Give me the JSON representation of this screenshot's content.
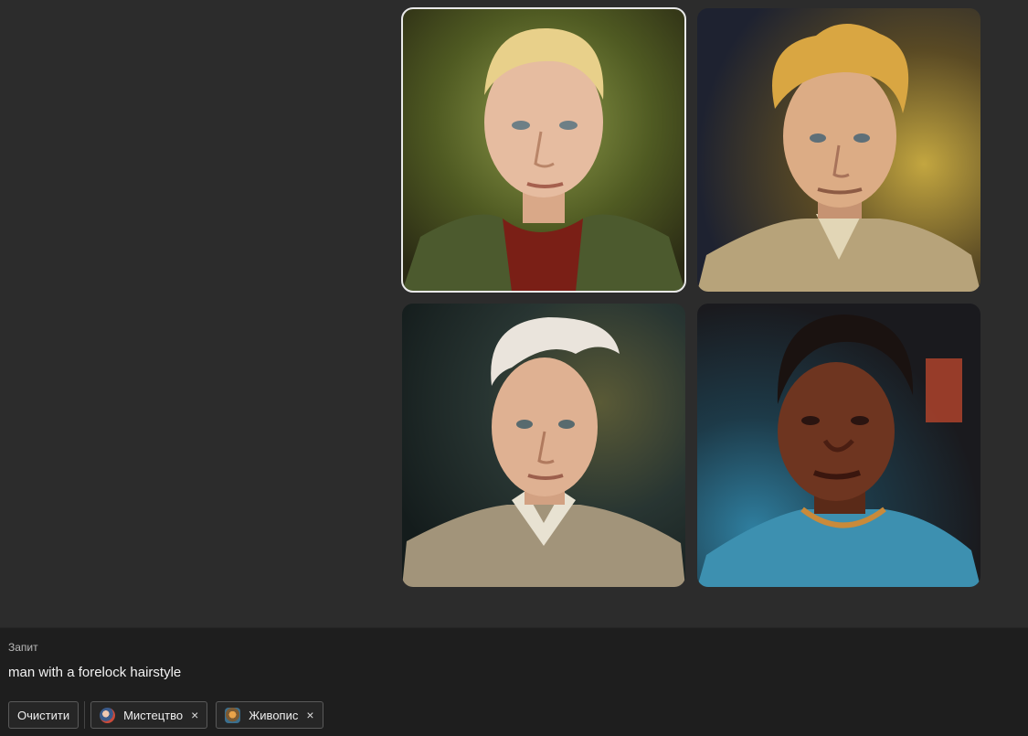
{
  "prompt": {
    "label": "Запит",
    "text": "man with a forelock hairstyle"
  },
  "actions": {
    "clear_label": "Очистити"
  },
  "style_chips": [
    {
      "label": "Мистецтво",
      "icon": "art-style-thumb"
    },
    {
      "label": "Живопис",
      "icon": "painting-style-thumb"
    }
  ],
  "gallery": {
    "selected_index": 0,
    "images": [
      {
        "subject": "blonde man, green jacket, red scarf",
        "background": "#4a5a2a"
      },
      {
        "subject": "blonde man, tousled hair, beige shirt",
        "background": "#3a3424"
      },
      {
        "subject": "platinum-haired man, forelock, sweater",
        "background": "#1f2a28"
      },
      {
        "subject": "dark-skinned man, short hair, blue shirt",
        "background": "#1d3a48"
      }
    ]
  },
  "colors": {
    "background": "#2c2c2c",
    "panel": "#1e1e1e",
    "selection_outline": "#e9e9e9"
  }
}
